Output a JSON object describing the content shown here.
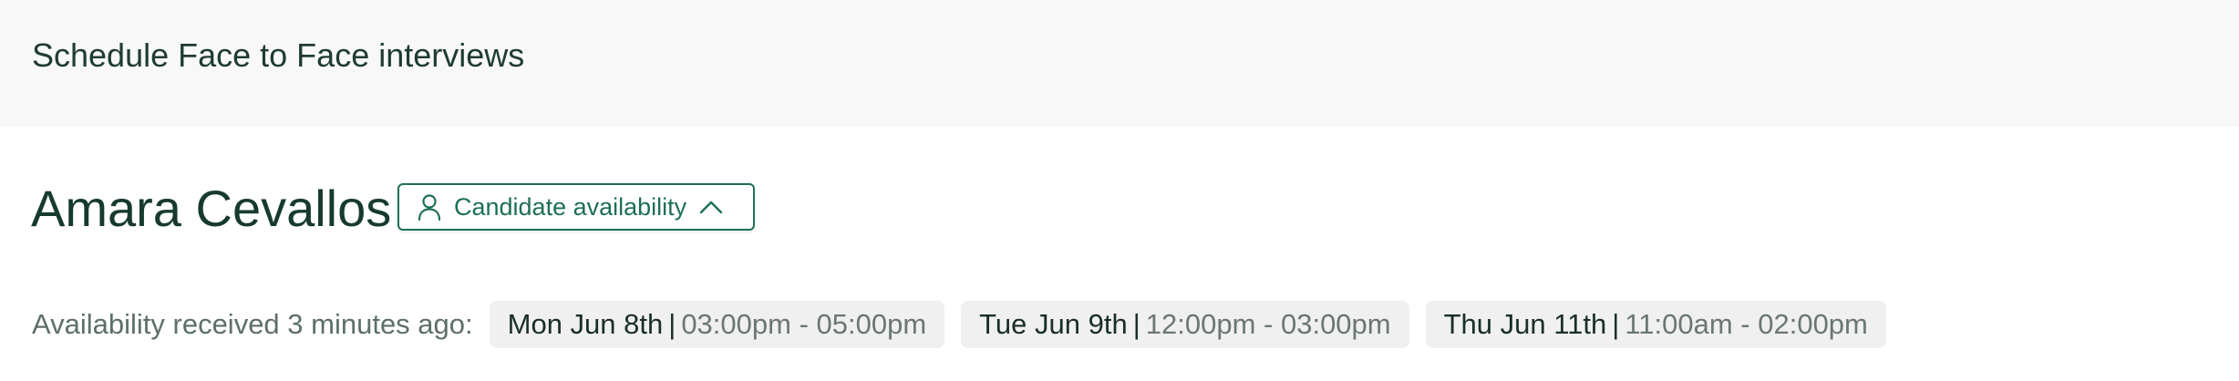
{
  "header": {
    "title": "Schedule Face to Face interviews"
  },
  "candidate": {
    "name": "Amara Cevallos",
    "availability_button_label": "Candidate availability",
    "availability_expanded": true
  },
  "availability": {
    "received_label": "Availability received 3 minutes ago:",
    "separator": "|",
    "slots": [
      {
        "day": "Mon Jun 8th",
        "time": "03:00pm - 05:00pm"
      },
      {
        "day": "Tue Jun 9th",
        "time": "12:00pm - 03:00pm"
      },
      {
        "day": "Thu Jun 11th",
        "time": "11:00am - 02:00pm"
      }
    ]
  },
  "icons": {
    "availability_button_icon": "person-icon",
    "availability_toggle_icon": "chevron-up-icon"
  },
  "colors": {
    "accent": "#1e6f55",
    "header_background": "#f8f8f8",
    "slot_background": "#f0f0f0"
  }
}
